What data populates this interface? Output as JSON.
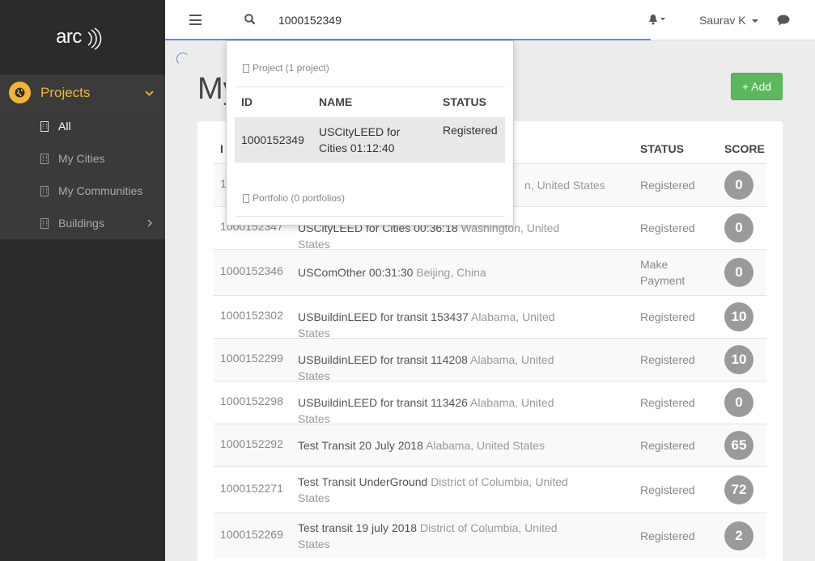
{
  "sidebar": {
    "logo": "arc",
    "section": "Projects",
    "items": [
      {
        "label": "All",
        "active": true
      },
      {
        "label": "My Cities"
      },
      {
        "label": "My Communities"
      },
      {
        "label": "Buildings"
      }
    ]
  },
  "topbar": {
    "search_value": "1000152349",
    "user": "Saurav K"
  },
  "page": {
    "title": "My",
    "add_button": "+ Add"
  },
  "table": {
    "headers": {
      "id": "I",
      "status": "STATUS",
      "score": "SCORE"
    },
    "rows": [
      {
        "id": "1",
        "name": "",
        "loc": "n, United States",
        "status": "Registered",
        "score": "0"
      },
      {
        "id": "1000152347",
        "name": "USCityLEED for Cities 00:36:18",
        "loc": "Washington, United States",
        "status": "Registered",
        "score": "0"
      },
      {
        "id": "1000152346",
        "name": "USComOther 00:31:30",
        "loc": "Beijing, China",
        "status": "Make Payment",
        "score": "0"
      },
      {
        "id": "1000152302",
        "name": "USBuildinLEED for transit 153437",
        "loc": "Alabama, United States",
        "status": "Registered",
        "score": "10"
      },
      {
        "id": "1000152299",
        "name": "USBuildinLEED for transit 114208",
        "loc": "Alabama, United States",
        "status": "Registered",
        "score": "10"
      },
      {
        "id": "1000152298",
        "name": "USBuildinLEED for transit 113426",
        "loc": "Alabama, United States",
        "status": "Registered",
        "score": "0"
      },
      {
        "id": "1000152292",
        "name": "Test Transit 20 July 2018",
        "loc": "Alabama, United States",
        "status": "Registered",
        "score": "65"
      },
      {
        "id": "1000152271",
        "name": "Test Transit UnderGround",
        "loc": "District of Columbia, United States",
        "status": "Registered",
        "score": "72"
      },
      {
        "id": "1000152269",
        "name": "Test transit 19 july 2018",
        "loc": "District of Columbia, United States",
        "status": "Registered",
        "score": "2"
      }
    ]
  },
  "dropdown": {
    "project_section": "Project (1 project)",
    "portfolio_section": "Portfolio (0 portfolios)",
    "headers": {
      "id": "ID",
      "name": "NAME",
      "status": "STATUS"
    },
    "result": {
      "id": "1000152349",
      "name": "USCityLEED for Cities 01:12:40",
      "status": "Registered"
    }
  },
  "colors": {
    "accent": "#f2b632",
    "add_button": "#5cb85c",
    "score_badge": "#9a9a9a"
  }
}
